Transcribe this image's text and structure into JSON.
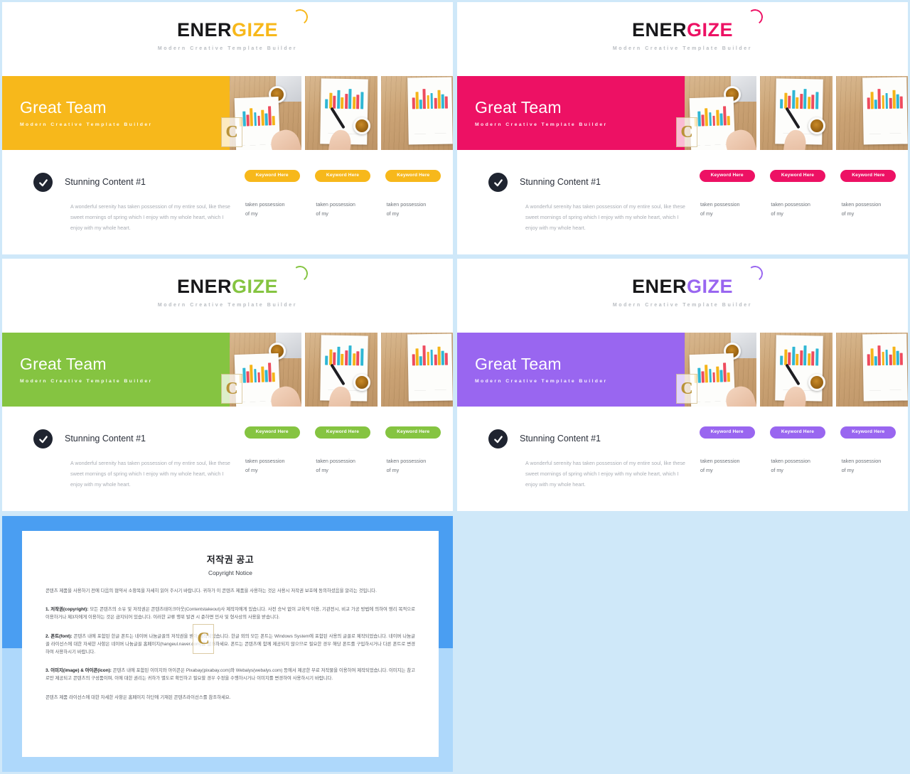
{
  "page": {
    "background_color": "#cfe8f9"
  },
  "slides": [
    {
      "id": "slide-yellow",
      "accent": "#f7b81b",
      "logo": {
        "part1": "ENER",
        "part2": "GIZE"
      },
      "tagline": "Modern Creative Template Builder",
      "banner": {
        "title": "Great Team",
        "subtitle": "Modern Creative Template Builder"
      },
      "content": {
        "heading": "Stunning Content #1",
        "body": "A wonderful serenity has taken possession of my entire soul, like these sweet mornings of spring which I enjoy with my whole heart, which I enjoy with my whole heart.",
        "columns": [
          {
            "pill": "Keyword Here",
            "line1": "taken possession",
            "line2": "of my"
          },
          {
            "pill": "Keyword Here",
            "line1": "taken possession",
            "line2": "of my"
          },
          {
            "pill": "Keyword Here",
            "line1": "taken possession",
            "line2": "of my"
          }
        ]
      }
    },
    {
      "id": "slide-pink",
      "accent": "#ed1164",
      "logo": {
        "part1": "ENER",
        "part2": "GIZE"
      },
      "tagline": "Modern Creative Template Builder",
      "banner": {
        "title": "Great Team",
        "subtitle": "Modern Creative Template Builder"
      },
      "content": {
        "heading": "Stunning Content #1",
        "body": "A wonderful serenity has taken possession of my entire soul, like these sweet mornings of spring which I enjoy with my whole heart, which I enjoy with my whole heart.",
        "columns": [
          {
            "pill": "Keyword Here",
            "line1": "taken possession",
            "line2": "of my"
          },
          {
            "pill": "Keyword Here",
            "line1": "taken possession",
            "line2": "of my"
          },
          {
            "pill": "Keyword Here",
            "line1": "taken possession",
            "line2": "of my"
          }
        ]
      }
    },
    {
      "id": "slide-green",
      "accent": "#85c441",
      "logo": {
        "part1": "ENER",
        "part2": "GIZE"
      },
      "tagline": "Modern Creative Template Builder",
      "banner": {
        "title": "Great Team",
        "subtitle": "Modern Creative Template Builder"
      },
      "content": {
        "heading": "Stunning Content #1",
        "body": "A wonderful serenity has taken possession of my entire soul, like these sweet mornings of spring which I enjoy with my whole heart, which I enjoy with my whole heart.",
        "columns": [
          {
            "pill": "Keyword Here",
            "line1": "taken possession",
            "line2": "of my"
          },
          {
            "pill": "Keyword Here",
            "line1": "taken possession",
            "line2": "of my"
          },
          {
            "pill": "Keyword Here",
            "line1": "taken possession",
            "line2": "of my"
          }
        ]
      }
    },
    {
      "id": "slide-purple",
      "accent": "#9966f0",
      "logo": {
        "part1": "ENER",
        "part2": "GIZE"
      },
      "tagline": "Modern Creative Template Builder",
      "banner": {
        "title": "Great Team",
        "subtitle": "Modern Creative Template Builder"
      },
      "content": {
        "heading": "Stunning Content #1",
        "body": "A wonderful serenity has taken possession of my entire soul, like these sweet mornings of spring which I enjoy with my whole heart, which I enjoy with my whole heart.",
        "columns": [
          {
            "pill": "Keyword Here",
            "line1": "taken possession",
            "line2": "of my"
          },
          {
            "pill": "Keyword Here",
            "line1": "taken possession",
            "line2": "of my"
          },
          {
            "pill": "Keyword Here",
            "line1": "taken possession",
            "line2": "of my"
          }
        ]
      }
    }
  ],
  "copyright": {
    "band_color": "#4a9ef2",
    "band_color_light": "#aed8fb",
    "title": "저작권 공고",
    "subtitle": "Copyright Notice",
    "intro": "콘텐츠 제품을 사용하기 전에 다음의 협약서 소항목을 자세히 읽어 주시기 바랍니다. 귀하가 이 콘텐츠 제품을 사용하는 것은 사용시 저작권 보호에 동의하셨음을 알리는 것입니다.",
    "section1_label": "1. 저작권(copyright):",
    "section1_text": " 모든 콘텐츠의 소유 및 저작권은 콘텐츠테이크아웃(Contentstakeout)사 제작자에게 있습니다. 사전 승낙 없이 교육적 이용, 기관전시, 비교 가공 방법에 의하여 영리 목적으로 이용하거나 제3자에게 이용하는 것은 금지되어 있습니다. 이러한 교류 행위 발견 시 준하면 민사 및 형사상의 사용을 받습니다.",
    "section2_label": "2. 폰트(font):",
    "section2_text": " 콘텐츠 내에 포함된 한글 폰트는 네이버 나눔글꼴의 저작권을 받아 제작되었습니다. 한글 외의 모든 폰트는 Windows System에 포함된 사용의 글꼴로 제작되었습니다. 네이버 나눔글꼴 라이선스에 대한 자세한 사항은 네이버 나눔글꼴 홈페이지(hangeul.naver.com)를 참조하세요. 폰트는 콘텐츠에 함께 제공되지 않으므로 필요한 경우 해당 폰트를 구입하시거나 다른 폰트로 변경하여 사용하시기 바랍니다.",
    "section3_label": "3. 이미지(image) & 아이콘(icon):",
    "section3_text": " 콘텐츠 내에 포함된 이미지와 아이콘은 Pixabay(pixabay.com)와 Webalys(webalys.com) 등에서 제공한 무료 저작물을 이용하여 제작되었습니다. 이미지는 참고로만 제공되고 콘텐츠의 구성품이며, 이에 대한 권리는 귀하가 별도로 확인하고 필요할 경우 수정을 수행하시거나 이미지를 변경하여 사용하시기 바랍니다.",
    "footer": "콘텐츠 제품 라이선스에 대한 자세한 사항은 홈페이지 하단에 기재된 콘텐츠라이선스를 참조하세요.",
    "watermark": "C"
  }
}
